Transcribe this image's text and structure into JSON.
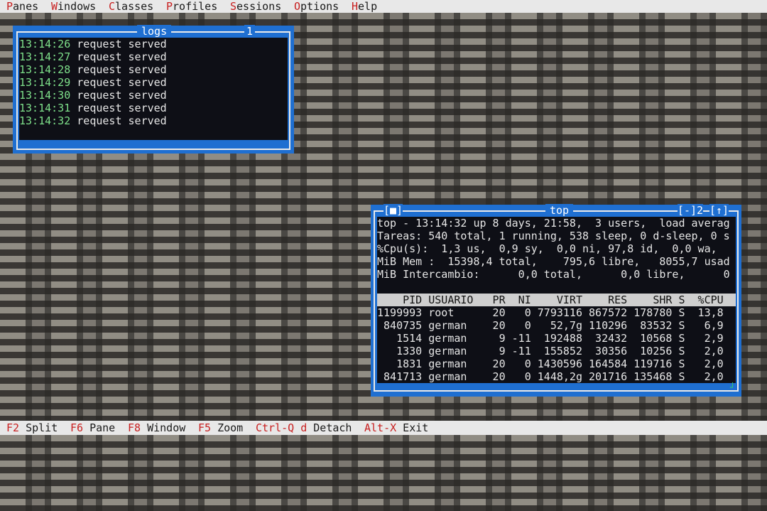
{
  "menu": {
    "items": [
      {
        "hot": "P",
        "rest": "anes"
      },
      {
        "hot": "W",
        "rest": "indows"
      },
      {
        "hot": "C",
        "rest": "lasses"
      },
      {
        "hot": "P",
        "rest": "rofiles"
      },
      {
        "hot": "S",
        "rest": "essions"
      },
      {
        "hot": "O",
        "rest": "ptions"
      },
      {
        "hot": "H",
        "rest": "elp"
      }
    ]
  },
  "statusbar": {
    "items": [
      {
        "key": "F2",
        "label": " Split"
      },
      {
        "key": "F6",
        "label": " Pane"
      },
      {
        "key": "F8",
        "label": " Window"
      },
      {
        "key": "F5",
        "label": " Zoom"
      },
      {
        "key": "Ctrl-Q d",
        "label": " Detach"
      },
      {
        "key": "Alt-X",
        "label": " Exit"
      }
    ]
  },
  "logs_window": {
    "title": "logs",
    "number": "1",
    "lines": [
      {
        "time": "13:14:26",
        "text": " request served"
      },
      {
        "time": "13:14:27",
        "text": " request served"
      },
      {
        "time": "13:14:28",
        "text": " request served"
      },
      {
        "time": "13:14:29",
        "text": " request served"
      },
      {
        "time": "13:14:30",
        "text": " request served"
      },
      {
        "time": "13:14:31",
        "text": " request served"
      },
      {
        "time": "13:14:32",
        "text": " request served"
      }
    ]
  },
  "top_window": {
    "title": "top",
    "close_button": "[■]",
    "minimize_button": "[-]",
    "number": "2",
    "maximize_button": "[↑]",
    "summary": [
      "top - 13:14:32 up 8 days, 21:58,  3 users,  load averag",
      "Tareas: 540 total, 1 running, 538 sleep, 0 d-sleep, 0 s",
      "%Cpu(s):  1,3 us,  0,9 sy,  0,0 ni, 97,8 id,  0,0 wa,",
      "MiB Mem :  15398,4 total,    795,6 libre,   8055,7 usad",
      "MiB Intercambio:      0,0 total,      0,0 libre,      0",
      ""
    ],
    "table_header": "    PID USUARIO   PR  NI    VIRT    RES    SHR S  %CPU ",
    "rows": [
      "1199993 root      20   0 7793116 867572 178780 S  13,8",
      " 840735 german    20   0   52,7g 110296  83532 S   6,9",
      "   1514 german     9 -11  192488  32432  10568 S   2,9",
      "   1330 german     9 -11  155852  30356  10256 S   2,0",
      "   1831 german    20   0 1430596 164584 119716 S   2,0",
      " 841713 german    20   0 1448,2g 201716 135468 S   2,0"
    ]
  }
}
